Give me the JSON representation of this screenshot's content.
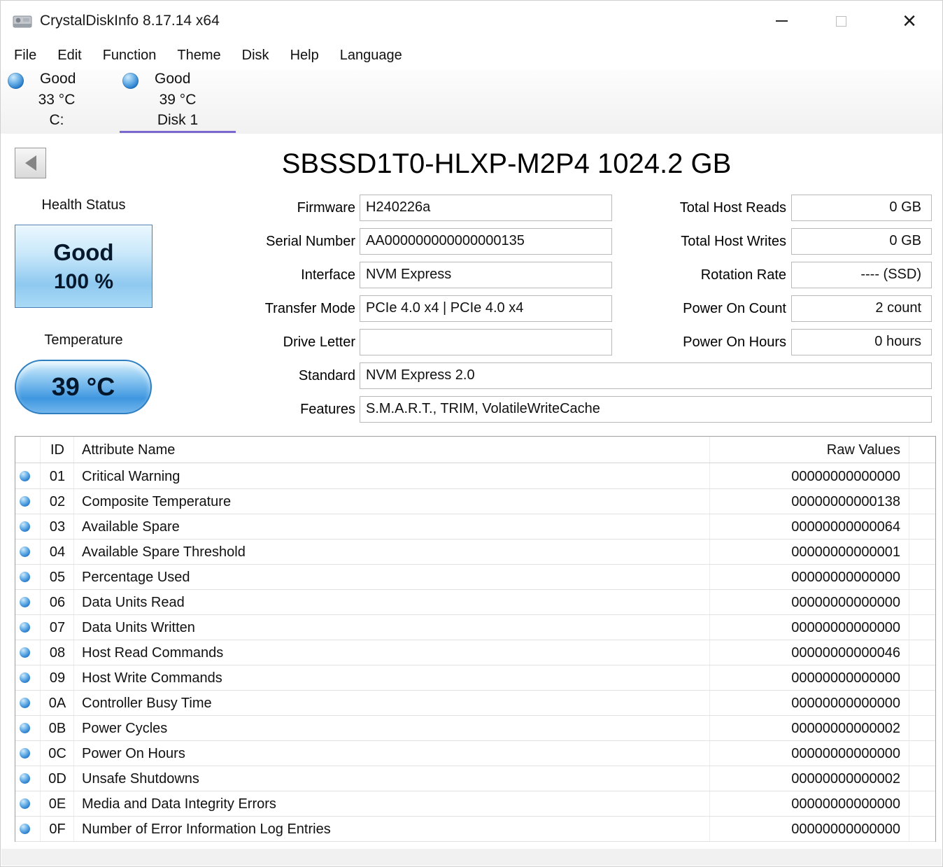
{
  "window": {
    "title": "CrystalDiskInfo 8.17.14 x64"
  },
  "icons": {
    "close": "×"
  },
  "menu": [
    "File",
    "Edit",
    "Function",
    "Theme",
    "Disk",
    "Help",
    "Language"
  ],
  "disks": [
    {
      "status": "Good",
      "temperature": "33 °C",
      "name": "C:",
      "selected": false
    },
    {
      "status": "Good",
      "temperature": "39 °C",
      "name": "Disk 1",
      "selected": true
    }
  ],
  "drive": {
    "title": "SBSSD1T0-HLXP-M2P4 1024.2 GB",
    "health_label": "Health Status",
    "health_status": "Good",
    "health_percent": "100 %",
    "temperature_label": "Temperature",
    "temperature_value": "39 °C"
  },
  "info_fields": [
    {
      "label": "Firmware",
      "value": "H240226a"
    },
    {
      "label": "Serial Number",
      "value": "AA000000000000000135"
    },
    {
      "label": "Interface",
      "value": "NVM Express"
    },
    {
      "label": "Transfer Mode",
      "value": "PCIe 4.0 x4 | PCIe 4.0 x4"
    },
    {
      "label": "Drive Letter",
      "value": ""
    },
    {
      "label": "Standard",
      "value": "NVM Express 2.0"
    },
    {
      "label": "Features",
      "value": "S.M.A.R.T., TRIM, VolatileWriteCache"
    }
  ],
  "stat_fields": [
    {
      "label": "Total Host Reads",
      "value": "0 GB"
    },
    {
      "label": "Total Host Writes",
      "value": "0 GB"
    },
    {
      "label": "Rotation Rate",
      "value": "---- (SSD)"
    },
    {
      "label": "Power On Count",
      "value": "2 count"
    },
    {
      "label": "Power On Hours",
      "value": "0 hours"
    }
  ],
  "smart": {
    "headers": {
      "id": "ID",
      "name": "Attribute Name",
      "raw": "Raw Values"
    },
    "rows": [
      {
        "id": "01",
        "name": "Critical Warning",
        "raw": "00000000000000"
      },
      {
        "id": "02",
        "name": "Composite Temperature",
        "raw": "00000000000138"
      },
      {
        "id": "03",
        "name": "Available Spare",
        "raw": "00000000000064"
      },
      {
        "id": "04",
        "name": "Available Spare Threshold",
        "raw": "00000000000001"
      },
      {
        "id": "05",
        "name": "Percentage Used",
        "raw": "00000000000000"
      },
      {
        "id": "06",
        "name": "Data Units Read",
        "raw": "00000000000000"
      },
      {
        "id": "07",
        "name": "Data Units Written",
        "raw": "00000000000000"
      },
      {
        "id": "08",
        "name": "Host Read Commands",
        "raw": "00000000000046"
      },
      {
        "id": "09",
        "name": "Host Write Commands",
        "raw": "00000000000000"
      },
      {
        "id": "0A",
        "name": "Controller Busy Time",
        "raw": "00000000000000"
      },
      {
        "id": "0B",
        "name": "Power Cycles",
        "raw": "00000000000002"
      },
      {
        "id": "0C",
        "name": "Power On Hours",
        "raw": "00000000000000"
      },
      {
        "id": "0D",
        "name": "Unsafe Shutdowns",
        "raw": "00000000000002"
      },
      {
        "id": "0E",
        "name": "Media and Data Integrity Errors",
        "raw": "00000000000000"
      },
      {
        "id": "0F",
        "name": "Number of Error Information Log Entries",
        "raw": "00000000000000"
      }
    ]
  },
  "colors": {
    "selected_tab_underline": "#7b68cf",
    "status_dot_blue": "#2277c8",
    "health_button_blue": "#8fc9f0",
    "temperature_pill_blue": "#3f97e0",
    "field_border": "#b9b9b9"
  }
}
